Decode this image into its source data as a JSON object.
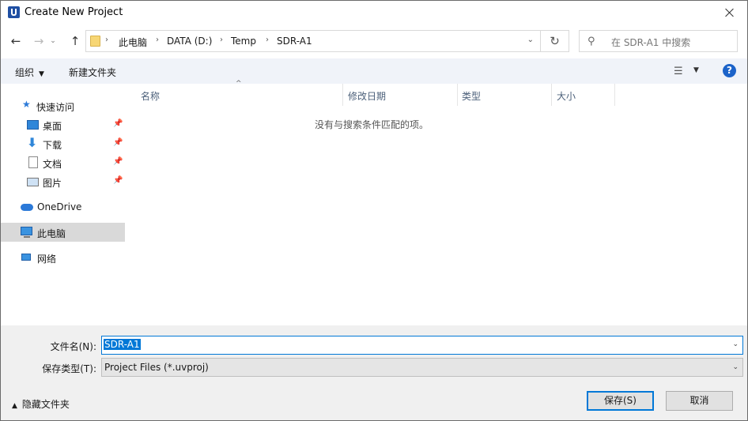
{
  "window": {
    "title": "Create New Project"
  },
  "address": {
    "crumbs": [
      "此电脑",
      "DATA (D:)",
      "Temp",
      "SDR-A1"
    ],
    "separator": "›"
  },
  "search": {
    "placeholder": "在 SDR-A1 中搜索"
  },
  "toolbar": {
    "organize": "组织",
    "new_folder": "新建文件夹"
  },
  "nav": {
    "quick_access": "快速访问",
    "items": [
      {
        "label": "桌面",
        "icon": "desktop-icon",
        "pinned": true
      },
      {
        "label": "下载",
        "icon": "download-icon",
        "pinned": true
      },
      {
        "label": "文档",
        "icon": "documents-icon",
        "pinned": true
      },
      {
        "label": "图片",
        "icon": "pictures-icon",
        "pinned": true
      }
    ],
    "onedrive": "OneDrive",
    "this_pc": "此电脑",
    "network": "网络"
  },
  "columns": [
    "名称",
    "修改日期",
    "类型",
    "大小"
  ],
  "empty_message": "没有与搜索条件匹配的项。",
  "filename": {
    "label": "文件名(N):",
    "value": "SDR-A1"
  },
  "filetype": {
    "label": "保存类型(T):",
    "value": "Project Files (*.uvproj)"
  },
  "hide_folders": "隐藏文件夹",
  "buttons": {
    "save": "保存(S)",
    "cancel": "取消"
  },
  "colors": {
    "accent": "#0078d7",
    "toolbar_bg": "#f0f3f9",
    "bottom_bg": "#f0f0f0",
    "selected_nav": "#d9d9d9"
  }
}
